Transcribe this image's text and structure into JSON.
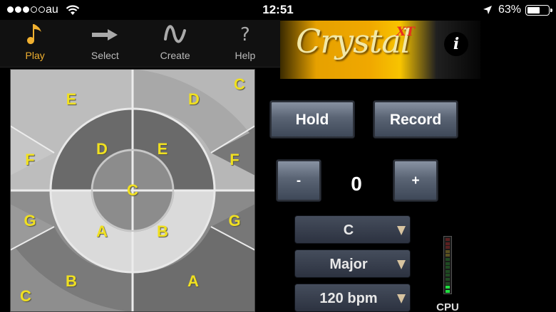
{
  "status_bar": {
    "carrier": "au",
    "time": "12:51",
    "battery_percent_text": "63%",
    "battery_level": 0.63,
    "signal_dots_filled": 3,
    "signal_dots_total": 5
  },
  "tabs": [
    {
      "label": "Play",
      "icon": "music-note-icon",
      "active": true
    },
    {
      "label": "Select",
      "icon": "arrow-icon",
      "active": false
    },
    {
      "label": "Create",
      "icon": "wave-icon",
      "active": false
    },
    {
      "label": "Help",
      "icon": "question-icon",
      "active": false
    }
  ],
  "logo": {
    "brand": "Crystal",
    "suffix": "XT",
    "info_label": "i"
  },
  "pad": {
    "notes": {
      "corner_tl": "E",
      "corner_tr_outer": "D",
      "corner_tr_tip": "C",
      "left_upper": "F",
      "right_upper": "F",
      "left_lower": "G",
      "right_lower": "G",
      "corner_bl_outer": "B",
      "corner_bl_tip": "C",
      "corner_br_outer": "A",
      "ring_tl": "D",
      "ring_tr": "E",
      "ring_bl": "A",
      "ring_br": "B",
      "center": "C"
    }
  },
  "controls": {
    "hold_label": "Hold",
    "record_label": "Record",
    "minus_label": "-",
    "plus_label": "+",
    "transpose_value": "0",
    "key_value": "C",
    "scale_value": "Major",
    "tempo_value": "120 bpm"
  },
  "cpu": {
    "label": "CPU",
    "level": 0.15
  },
  "colors": {
    "accent": "#f0b030",
    "note_text": "#f0e020"
  }
}
